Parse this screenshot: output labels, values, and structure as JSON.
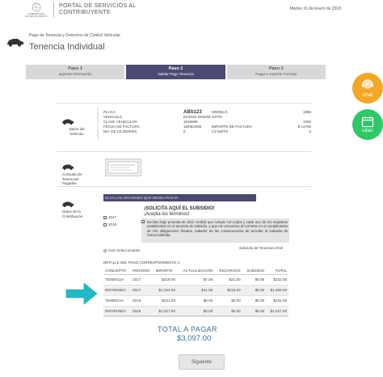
{
  "header": {
    "logo_text": "GOBIERNO DEL ESTADO DE MÉXICO",
    "portal_line1": "PORTAL DE SERVICIOS AL",
    "portal_line2": "CONTRIBUYENTE",
    "date": "Martes 16 de Enero de 2018"
  },
  "breadcrumb": "Pago de Tenencia y Derechos de Control Vehicular",
  "page_title": "Tenencia Individual",
  "steps": [
    {
      "title": "Paso 1",
      "desc": "Ingresar Información",
      "active": false
    },
    {
      "title": "Paso 2",
      "desc": "Validar Pago Tenencia",
      "active": true
    },
    {
      "title": "Paso 3",
      "desc": "Pagar e Imprimir Formato",
      "active": false
    }
  ],
  "fabs": {
    "chat": "chat",
    "citas": "citas"
  },
  "vehicle": {
    "section_label": "Datos del Vehículo",
    "fields": [
      {
        "label": "PLACA",
        "value": "ABS123"
      },
      {
        "label": "VEHICULO",
        "value": "DODGE DODGE EXTR."
      },
      {
        "label": "CLAVE VEHICULAR",
        "value": "1019999"
      },
      {
        "label": "FECHA DE FACTURA",
        "value": "16/06/2006"
      },
      {
        "label": "NO. DE CILINDROS",
        "value": "6"
      }
    ],
    "fields_right": [
      {
        "label": "MODELO",
        "value": "1996"
      },
      {
        "label": "",
        "value": ""
      },
      {
        "label": "",
        "value": "1000"
      },
      {
        "label": "IMPORTE DE FACTURA",
        "value": "$ 14756"
      },
      {
        "label": "C3 MOTO",
        "value": "0"
      }
    ]
  },
  "sections": {
    "consulta": "Consulta de Tenencias Pagadas",
    "contribucion": "Datos de la Contribución"
  },
  "payment": {
    "bar_label": "ELIJA LAS OPCIONES QUE DESEA PAGAR",
    "year_2017": "2017",
    "year_2018": "2018",
    "subsidy_title": "¡SOLICITA AQUÍ EL SUBSIDIO!",
    "subsidy_accept": "¡Acepta los términos!",
    "subsidy_text": "Declaro bajo protesta de decir verdad que cumplo con todos y cada uno de los requisitos establecidos en el acuerdo de subsidio, y que me encuentro al corriente en el cumplimiento de mis obligaciones fiscales, sabedor de las consecuencias de acceder al subsidio de forma indebida.",
    "subsidy_label": "Subsidio de Tenencia 2018",
    "solo_seleccionados": "Solo Seleccionados",
    "detail_title": "DETALLE DEL PAGO CORRESPONDIENTE A:"
  },
  "table": {
    "headers": [
      "CONCEPTO",
      "PERIODO",
      "IMPORTE",
      "ACTUALIZACIÓN",
      "RECARGOS",
      "SUBSIDIO",
      "TOTAL"
    ],
    "rows": [
      [
        "TENENCIA",
        "2017",
        "$218.00",
        "$7.00",
        "$21.00",
        "$0.00",
        "$232.00"
      ],
      [
        "REFRENDO",
        "2017",
        "$1,252.00",
        "$41.00",
        "$215.00",
        "$0.00",
        "$1,508.00"
      ],
      [
        "TENENCIA",
        "2018",
        "$231.00",
        "$0.00",
        "$0.00",
        "$0.00",
        "$231.00"
      ],
      [
        "REFRENDO",
        "2018",
        "$1,027.00",
        "$0.00",
        "$0.00",
        "$0.00",
        "$1,027.00"
      ]
    ]
  },
  "total": {
    "label": "TOTAL A PAGAR",
    "amount": "$3,097.00"
  },
  "next_button": "Siguiente"
}
